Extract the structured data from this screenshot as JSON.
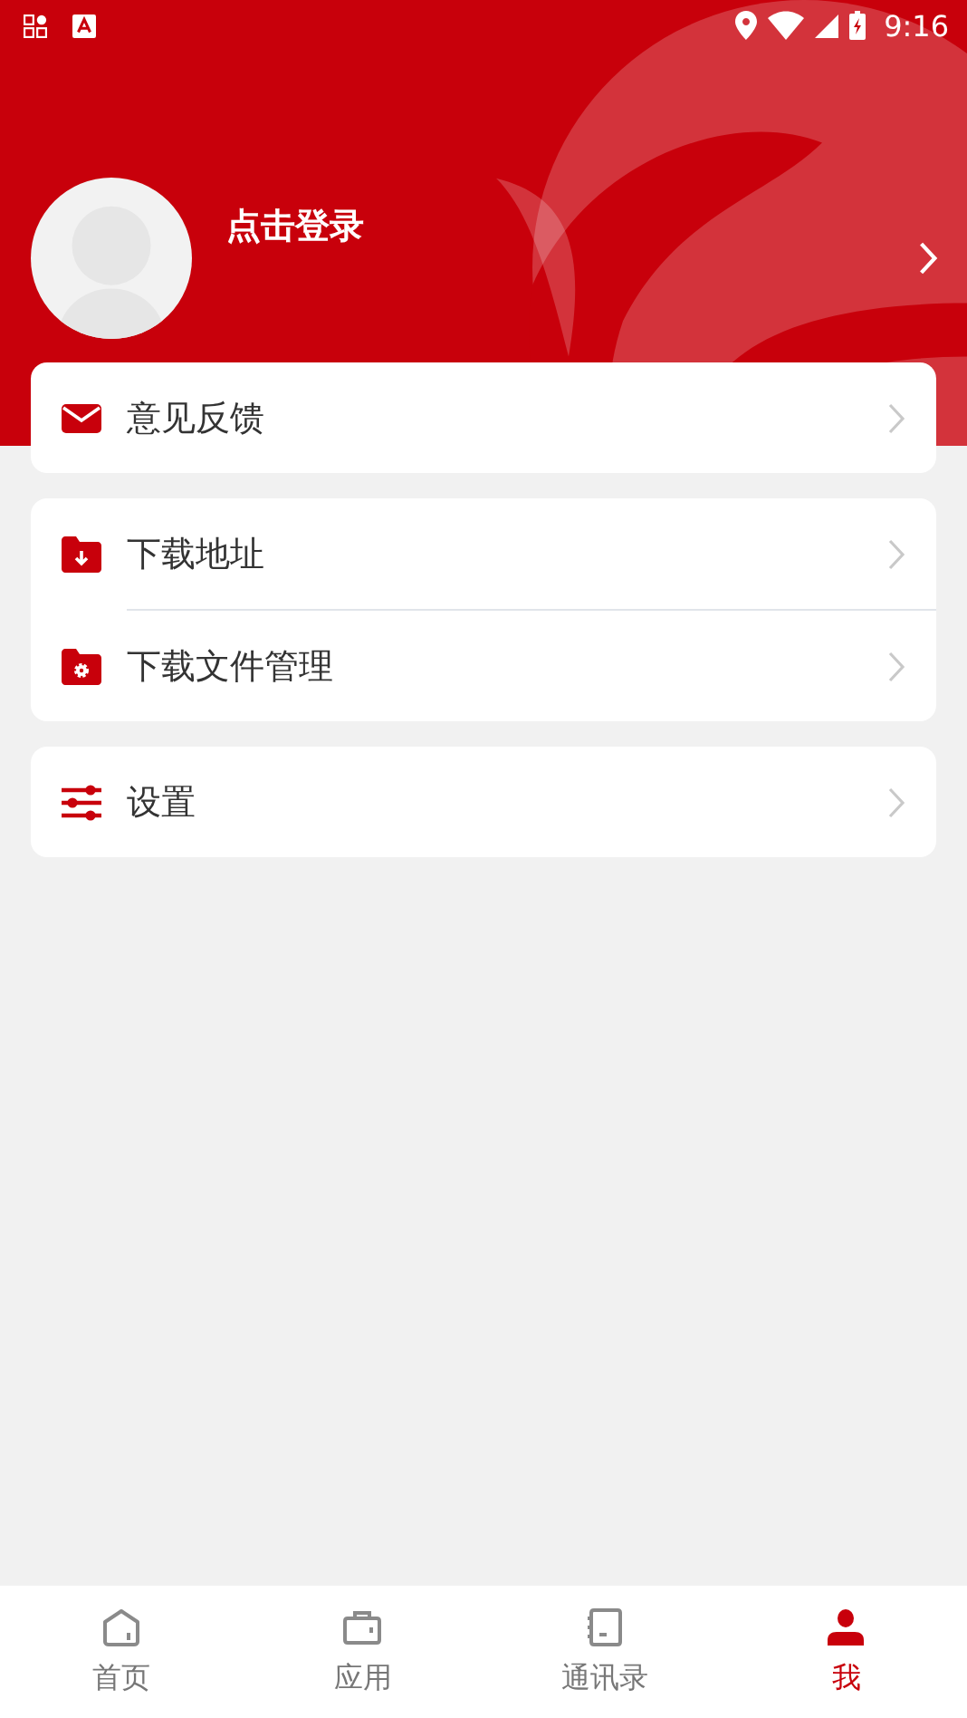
{
  "status_bar": {
    "time": "9:16"
  },
  "profile": {
    "login_text": "点击登录"
  },
  "menu_groups": [
    {
      "items": [
        {
          "kind": "mail",
          "label": "意见反馈"
        }
      ]
    },
    {
      "items": [
        {
          "kind": "download",
          "label": "下载地址"
        },
        {
          "kind": "folder-gear",
          "label": "下载文件管理"
        }
      ]
    },
    {
      "items": [
        {
          "kind": "sliders",
          "label": "设置"
        }
      ]
    }
  ],
  "tabs": [
    {
      "kind": "home",
      "label": "首页",
      "selected": false
    },
    {
      "kind": "apps",
      "label": "应用",
      "selected": false
    },
    {
      "kind": "contacts",
      "label": "通讯录",
      "selected": false
    },
    {
      "kind": "me",
      "label": "我",
      "selected": true
    }
  ]
}
